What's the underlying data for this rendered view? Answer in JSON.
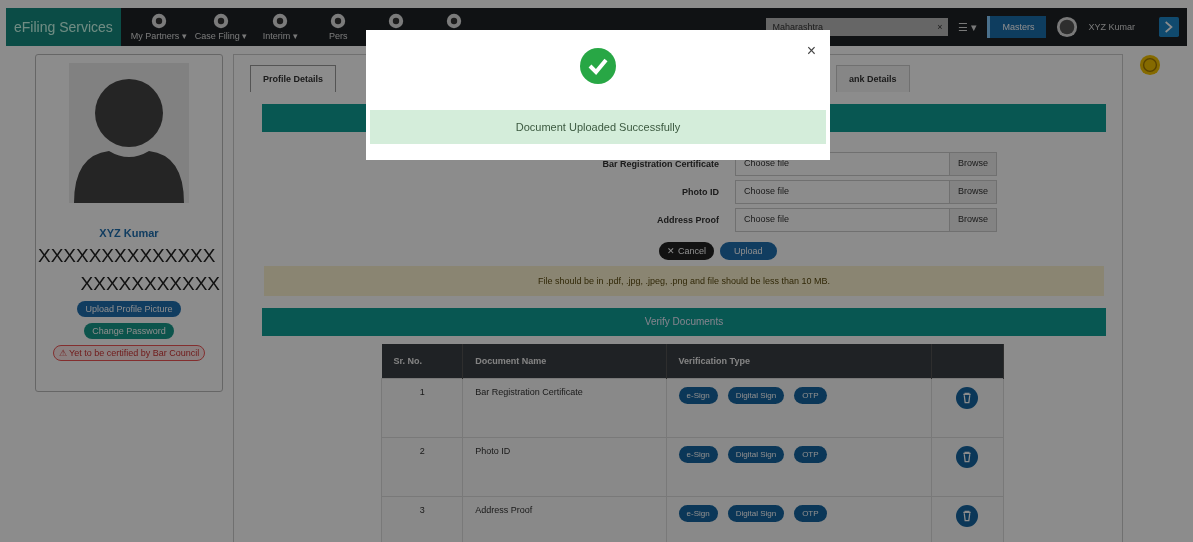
{
  "navbar": {
    "brand": "eFiling Services",
    "menus": [
      {
        "kind": "labeled",
        "label": "My Partners ▾"
      },
      {
        "kind": "labeled",
        "label": "Case Filing ▾"
      },
      {
        "kind": "labeled",
        "label": "Interim ▾"
      },
      {
        "kind": "labeled",
        "label": "Pers"
      },
      {
        "kind": "icon"
      },
      {
        "kind": "icon"
      }
    ],
    "state_select": "Maharashtra",
    "state_clear": "×",
    "list_menu": "☰ ▾",
    "role_button": "Masters",
    "user_name": "XYZ Kumar"
  },
  "profile": {
    "name": "XYZ Kumar",
    "line_1": "XXXXXXXXXXXXXX",
    "line_2": "XXXXXXXXXXX",
    "buttons": [
      {
        "label": "Upload Profile Picture",
        "kind": "upload"
      },
      {
        "label": "Change Password",
        "kind": "password"
      }
    ],
    "warning_icon": "⚠",
    "warning": "Yet to be certified by Bar Council"
  },
  "tabs": [
    {
      "label": "Profile Details",
      "selected": true
    },
    {
      "label": "ank Details",
      "selected": false
    }
  ],
  "upload_form": {
    "rows": [
      {
        "label": "Bar Registration Certificate",
        "placeholder": "Choose file",
        "browse": "Browse"
      },
      {
        "label": "Photo ID",
        "placeholder": "Choose file",
        "browse": "Browse"
      },
      {
        "label": "Address Proof",
        "placeholder": "Choose file",
        "browse": "Browse"
      }
    ],
    "cancel": "✕ Cancel",
    "upload": "Upload",
    "note": "File should be in .pdf, .jpg, .jpeg, .png and file should be less than 10 MB."
  },
  "verify": {
    "title": "Verify Documents",
    "columns": [
      "Sr. No.",
      "Document Name",
      "Verification Type"
    ],
    "rows": [
      {
        "no": "1",
        "name": "Bar Registration Certificate",
        "chips": [
          "e-Sign",
          "Digital Sign",
          "OTP"
        ]
      },
      {
        "no": "2",
        "name": "Photo ID",
        "chips": [
          "e-Sign",
          "Digital Sign",
          "OTP"
        ]
      },
      {
        "no": "3",
        "name": "Address Proof",
        "chips": [
          "e-Sign",
          "Digital Sign",
          "OTP"
        ]
      }
    ]
  },
  "modal": {
    "message": "Document Uploaded Successfully",
    "close": "×"
  }
}
